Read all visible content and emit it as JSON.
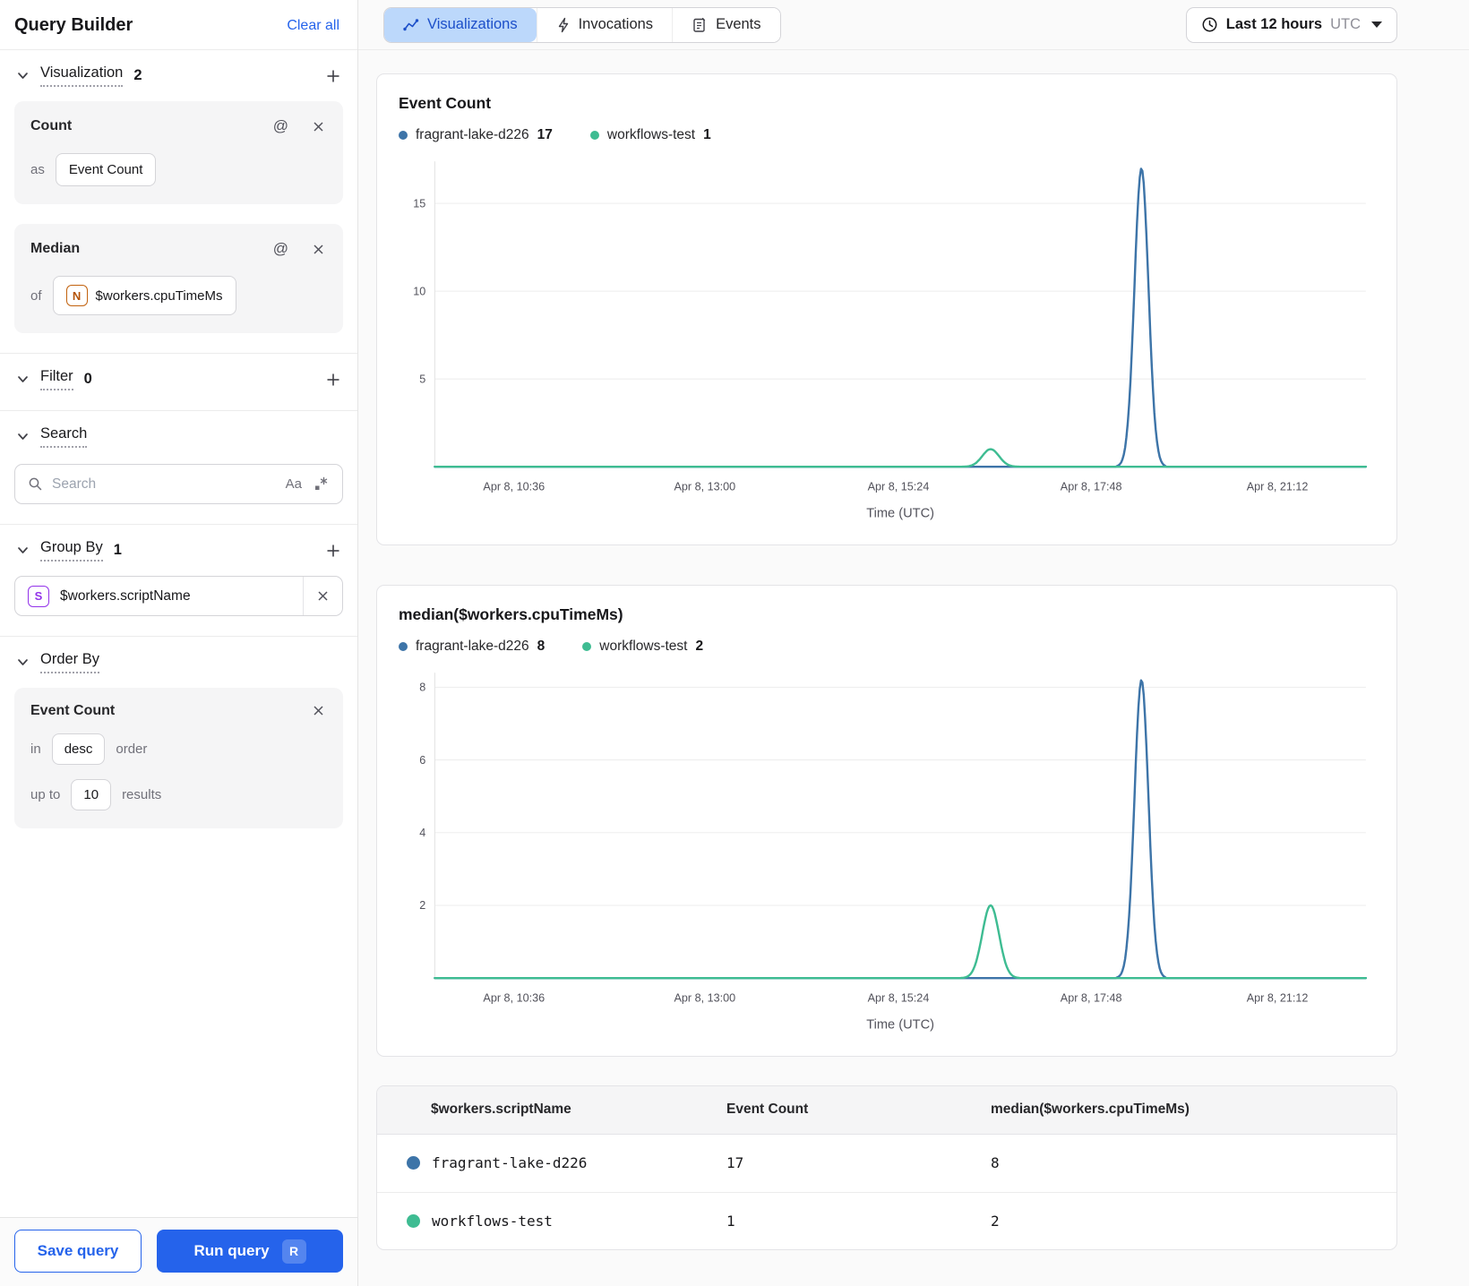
{
  "sidebar": {
    "title": "Query Builder",
    "clear_all": "Clear all",
    "sections": {
      "visualization": {
        "label": "Visualization",
        "count": "2"
      },
      "filter": {
        "label": "Filter",
        "count": "0"
      },
      "search": {
        "label": "Search"
      },
      "group_by": {
        "label": "Group By",
        "count": "1"
      },
      "order_by": {
        "label": "Order By"
      }
    },
    "viz_cards": [
      {
        "title": "Count",
        "prefix": "as",
        "value": "Event Count"
      },
      {
        "title": "Median",
        "prefix": "of",
        "badge": "N",
        "value": "$workers.cpuTimeMs"
      }
    ],
    "search_box": {
      "placeholder": "Search",
      "case_toggle": "Aa"
    },
    "group_items": [
      {
        "badge": "S",
        "value": "$workers.scriptName"
      }
    ],
    "order_card": {
      "field": "Event Count",
      "in_label": "in",
      "direction": "desc",
      "order_label": "order",
      "upto_label": "up to",
      "limit": "10",
      "results_label": "results"
    },
    "footer": {
      "save_label": "Save query",
      "run_label": "Run query",
      "run_shortcut": "R"
    }
  },
  "topbar": {
    "tabs": [
      {
        "label": "Visualizations",
        "active": true
      },
      {
        "label": "Invocations",
        "active": false
      },
      {
        "label": "Events",
        "active": false
      }
    ],
    "time_range": {
      "label": "Last 12 hours",
      "timezone": "UTC"
    }
  },
  "chart_data": [
    {
      "type": "line",
      "title": "Event Count",
      "xlabel": "Time (UTC)",
      "x_ticks": [
        "Apr 8, 10:36",
        "Apr 8, 13:00",
        "Apr 8, 15:24",
        "Apr 8, 17:48",
        "Apr 8, 21:12"
      ],
      "x_tick_fractions": [
        0.085,
        0.29,
        0.498,
        0.705,
        0.905
      ],
      "y_ticks": [
        5,
        10,
        15
      ],
      "y_max": 17.4,
      "grid": true,
      "legend_position": "top",
      "series": [
        {
          "name": "fragrant-lake-d226",
          "legend_value": "17",
          "color": "#3D74A8",
          "baseline_value": 0,
          "peak_value": 17,
          "peak_fraction": 0.759,
          "sigma": 0.0075
        },
        {
          "name": "workflows-test",
          "legend_value": "1",
          "color": "#3EBC92",
          "baseline_value": 0,
          "peak_value": 1,
          "peak_fraction": 0.597,
          "sigma": 0.009
        }
      ]
    },
    {
      "type": "line",
      "title": "median($workers.cpuTimeMs)",
      "xlabel": "Time (UTC)",
      "x_ticks": [
        "Apr 8, 10:36",
        "Apr 8, 13:00",
        "Apr 8, 15:24",
        "Apr 8, 17:48",
        "Apr 8, 21:12"
      ],
      "x_tick_fractions": [
        0.085,
        0.29,
        0.498,
        0.705,
        0.905
      ],
      "y_ticks": [
        2,
        4,
        6,
        8
      ],
      "y_max": 8.4,
      "grid": true,
      "legend_position": "top",
      "series": [
        {
          "name": "fragrant-lake-d226",
          "legend_value": "8",
          "color": "#3D74A8",
          "baseline_value": 0,
          "peak_value": 8.2,
          "peak_fraction": 0.759,
          "sigma": 0.0075
        },
        {
          "name": "workflows-test",
          "legend_value": "2",
          "color": "#3EBC92",
          "baseline_value": 0,
          "peak_value": 2,
          "peak_fraction": 0.597,
          "sigma": 0.009
        }
      ]
    }
  ],
  "table": {
    "columns": [
      "$workers.scriptName",
      "Event Count",
      "median($workers.cpuTimeMs)"
    ],
    "rows": [
      {
        "name": "fragrant-lake-d226",
        "color": "#3D74A8",
        "event_count": "17",
        "median": "8"
      },
      {
        "name": "workflows-test",
        "color": "#3EBC92",
        "event_count": "1",
        "median": "2"
      }
    ]
  }
}
